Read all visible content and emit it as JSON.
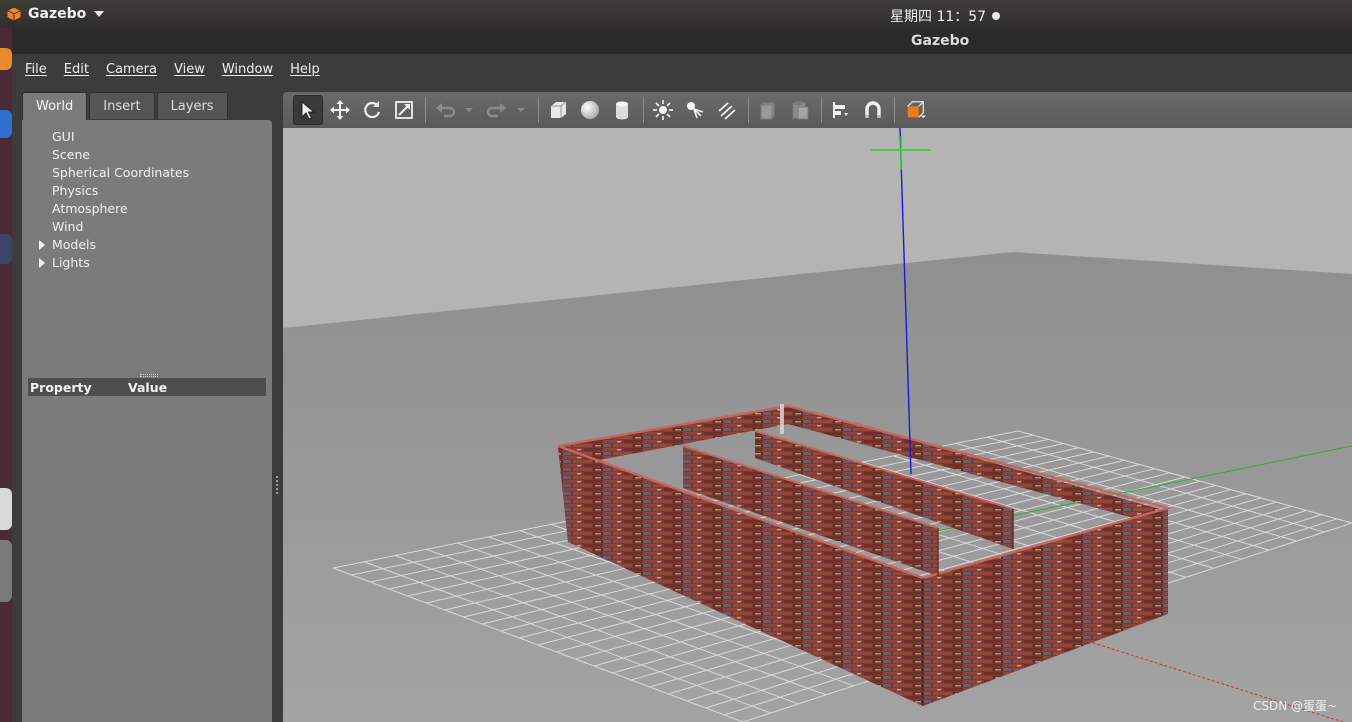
{
  "system_bar": {
    "app_name": "Gazebo",
    "clock": "星期四 11：57"
  },
  "window": {
    "title": "Gazebo"
  },
  "menubar": {
    "items": [
      "File",
      "Edit",
      "Camera",
      "View",
      "Window",
      "Help"
    ]
  },
  "left_panel": {
    "tabs": [
      "World",
      "Insert",
      "Layers"
    ],
    "active_tab": "World",
    "tree": [
      {
        "label": "GUI",
        "expandable": false
      },
      {
        "label": "Scene",
        "expandable": false
      },
      {
        "label": "Spherical Coordinates",
        "expandable": false
      },
      {
        "label": "Physics",
        "expandable": false
      },
      {
        "label": "Atmosphere",
        "expandable": false
      },
      {
        "label": "Wind",
        "expandable": false
      },
      {
        "label": "Models",
        "expandable": true
      },
      {
        "label": "Lights",
        "expandable": true
      }
    ],
    "property_table": {
      "col_property": "Property",
      "col_value": "Value"
    }
  },
  "toolbar": {
    "tools": [
      "select-mode",
      "translate-mode",
      "rotate-mode",
      "scale-mode",
      "undo",
      "redo",
      "box-shape",
      "sphere-shape",
      "cylinder-shape",
      "point-light",
      "spot-light",
      "directional-light",
      "copy",
      "paste",
      "align",
      "snap",
      "view-angle"
    ],
    "active_tool": "select-mode"
  },
  "watermark": "CSDN @蛋蛋~",
  "colors": {
    "brick": "#7a3b32",
    "brick_top": "#c7665a",
    "sky": "#b4b4b4",
    "ground": "#9c9c9c",
    "axis_z": "#1a1ad8",
    "axis_x": "#d63030",
    "axis_y": "#28b428",
    "accent_orange": "#f07b16"
  }
}
